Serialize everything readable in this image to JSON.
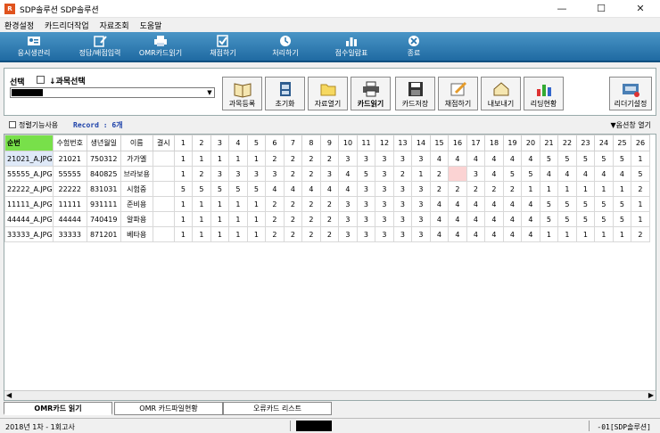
{
  "window": {
    "title": "SDP솔루션 SDP솔루션",
    "icon_text": "R"
  },
  "menu": [
    "환경설정",
    "카드리더작업",
    "자료조회",
    "도움말"
  ],
  "toolbar": [
    {
      "label": "응시생관리",
      "icon": "people-card-icon"
    },
    {
      "label": "정답/배점입력",
      "icon": "answer-edit-icon"
    },
    {
      "label": "OMR카드읽기",
      "icon": "printer-icon"
    },
    {
      "label": "채점하기",
      "icon": "check-icon"
    },
    {
      "label": "처리하기",
      "icon": "process-icon"
    },
    {
      "label": "점수일람표",
      "icon": "bar-chart-icon"
    },
    {
      "label": "종료",
      "icon": "close-icon"
    }
  ],
  "panel": {
    "select_label": "선택",
    "subject_label": "↓과목선택",
    "buttons": [
      {
        "label": "과목등록",
        "icon": "book-icon"
      },
      {
        "label": "초기화",
        "icon": "reset-icon"
      },
      {
        "label": "자료열기",
        "icon": "folder-icon"
      },
      {
        "label": "카드읽기",
        "icon": "printer-icon",
        "bold": true
      },
      {
        "label": "카드저장",
        "icon": "floppy-icon"
      },
      {
        "label": "채점하기",
        "icon": "pencil-icon"
      },
      {
        "label": "내보내기",
        "icon": "export-icon"
      },
      {
        "label": "리딩현황",
        "icon": "chart-icon"
      }
    ],
    "reader_button": "리더기설정"
  },
  "options": {
    "sort_label": "정렬기능사용",
    "record": "Record : 6개",
    "options_toggle": "▼옵션창 열기"
  },
  "grid": {
    "columns": [
      "순번",
      "수험번호",
      "생년월일",
      "이름",
      "결시",
      "1",
      "2",
      "3",
      "4",
      "5",
      "6",
      "7",
      "8",
      "9",
      "10",
      "11",
      "12",
      "13",
      "14",
      "15",
      "16",
      "17",
      "18",
      "19",
      "20",
      "21",
      "22",
      "23",
      "24",
      "25",
      "26"
    ],
    "rows": [
      [
        "21021_A.JPG",
        "21021",
        "750312",
        "가가엘",
        "",
        "1",
        "1",
        "1",
        "1",
        "1",
        "2",
        "2",
        "2",
        "2",
        "3",
        "3",
        "3",
        "3",
        "3",
        "4",
        "4",
        "4",
        "4",
        "4",
        "4",
        "5",
        "5",
        "5",
        "5",
        "5",
        "1"
      ],
      [
        "55555_A.JPG",
        "55555",
        "840825",
        "브라보용",
        "",
        "1",
        "2",
        "3",
        "3",
        "3",
        "3",
        "2",
        "2",
        "3",
        "4",
        "5",
        "3",
        "2",
        "1",
        "2",
        "",
        "3",
        "4",
        "5",
        "5",
        "4",
        "4",
        "4",
        "4",
        "4",
        "5"
      ],
      [
        "22222_A.JPG",
        "22222",
        "831031",
        "시험중",
        "",
        "5",
        "5",
        "5",
        "5",
        "5",
        "4",
        "4",
        "4",
        "4",
        "4",
        "3",
        "3",
        "3",
        "3",
        "2",
        "2",
        "2",
        "2",
        "2",
        "1",
        "1",
        "1",
        "1",
        "1",
        "1",
        "2"
      ],
      [
        "11111_A.JPG",
        "11111",
        "931111",
        "준비용",
        "",
        "1",
        "1",
        "1",
        "1",
        "1",
        "2",
        "2",
        "2",
        "2",
        "3",
        "3",
        "3",
        "3",
        "3",
        "4",
        "4",
        "4",
        "4",
        "4",
        "4",
        "5",
        "5",
        "5",
        "5",
        "5",
        "1"
      ],
      [
        "44444_A.JPG",
        "44444",
        "740419",
        "알파용",
        "",
        "1",
        "1",
        "1",
        "1",
        "1",
        "2",
        "2",
        "2",
        "2",
        "3",
        "3",
        "3",
        "3",
        "3",
        "4",
        "4",
        "4",
        "4",
        "4",
        "4",
        "5",
        "5",
        "5",
        "5",
        "5",
        "1"
      ],
      [
        "33333_A.JPG",
        "33333",
        "871201",
        "베타용",
        "",
        "1",
        "1",
        "1",
        "1",
        "1",
        "2",
        "2",
        "2",
        "2",
        "3",
        "3",
        "3",
        "3",
        "3",
        "4",
        "4",
        "4",
        "4",
        "4",
        "4",
        "1",
        "1",
        "1",
        "1",
        "1",
        "2"
      ]
    ],
    "empty_cell_color": "#fbd3d3"
  },
  "tabs": [
    "OMR카드 읽기",
    "OMR 카드파일현황",
    "오류카드 리스트"
  ],
  "status": {
    "left": "2018년 1차 - 1회고사",
    "right": "-01[SDP솔루션]"
  },
  "colors": {
    "toolbar": "#2a78b0",
    "selected_header": "#78e04a"
  }
}
